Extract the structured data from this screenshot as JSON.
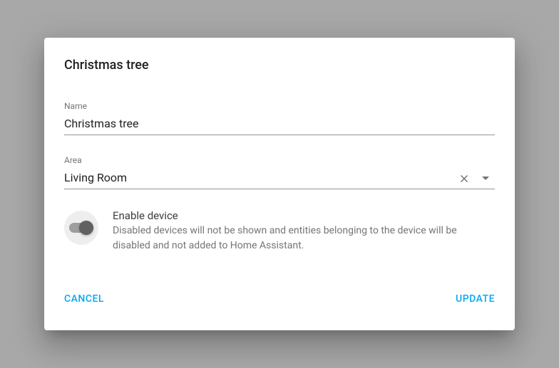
{
  "dialog": {
    "title": "Christmas tree"
  },
  "fields": {
    "name": {
      "label": "Name",
      "value": "Christmas tree"
    },
    "area": {
      "label": "Area",
      "value": "Living Room"
    }
  },
  "toggle": {
    "title": "Enable device",
    "description": "Disabled devices will not be shown and entities belonging to the device will be disabled and not added to Home Assistant."
  },
  "actions": {
    "cancel": "CANCEL",
    "update": "UPDATE"
  }
}
